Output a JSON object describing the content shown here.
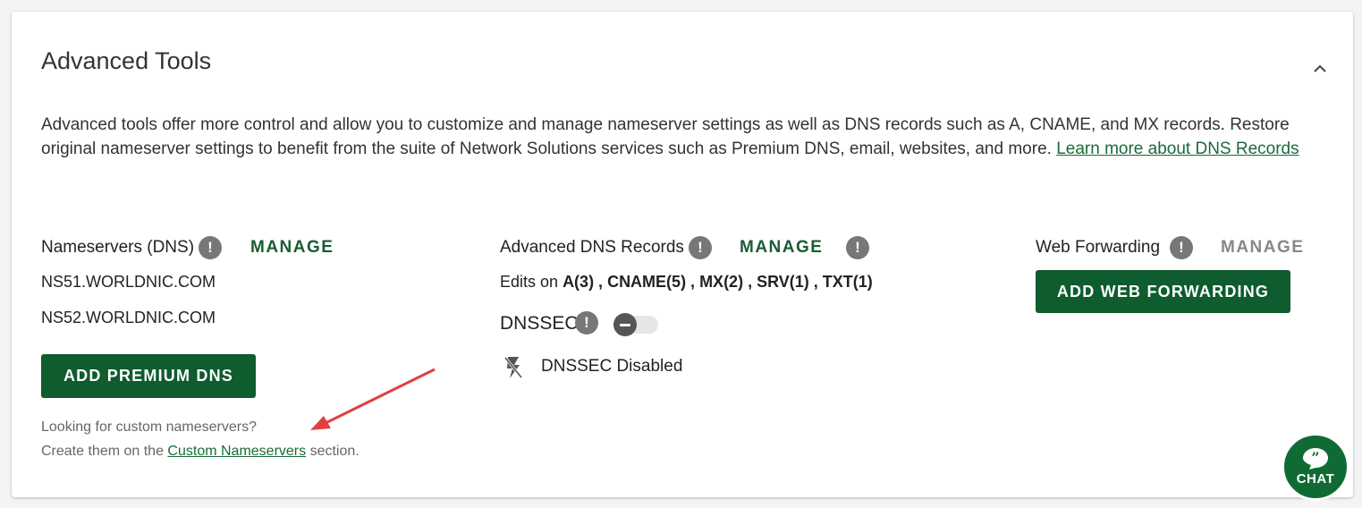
{
  "section": {
    "title": "Advanced Tools",
    "description": "Advanced tools offer more control and allow you to customize and manage nameserver settings as well as DNS records such as A, CNAME, and MX records. Restore original nameserver settings to benefit from the suite of Network Solutions services such as Premium DNS, email, websites, and more.",
    "learn_more_link": "Learn more about DNS Records"
  },
  "nameservers": {
    "label": "Nameservers (DNS)",
    "manage_label": "MANAGE",
    "servers": [
      "NS51.WORLDNIC.COM",
      "NS52.WORLDNIC.COM"
    ],
    "add_button": "ADD PREMIUM DNS",
    "hint_line1": "Looking for custom nameservers?",
    "hint_prefix": "Create them on the",
    "hint_link": "Custom Nameservers",
    "hint_suffix": "section."
  },
  "dns_records": {
    "label": "Advanced DNS Records",
    "manage_label": "MANAGE",
    "edits_prefix": "Edits on",
    "edits_values": "A(3) , CNAME(5) , MX(2) , SRV(1) , TXT(1)",
    "dnssec_label": "DNSSEC",
    "dnssec_enabled": false,
    "dnssec_status": "DNSSEC Disabled"
  },
  "web_forwarding": {
    "label": "Web Forwarding",
    "manage_label": "MANAGE",
    "add_button": "ADD WEB FORWARDING"
  },
  "info_glyph": "!",
  "chat": {
    "label": "CHAT"
  },
  "colors": {
    "brand_green": "#0f5c2e",
    "link_green": "#1a6b3a",
    "info_gray": "#777777",
    "annotation_red": "#e04040"
  }
}
